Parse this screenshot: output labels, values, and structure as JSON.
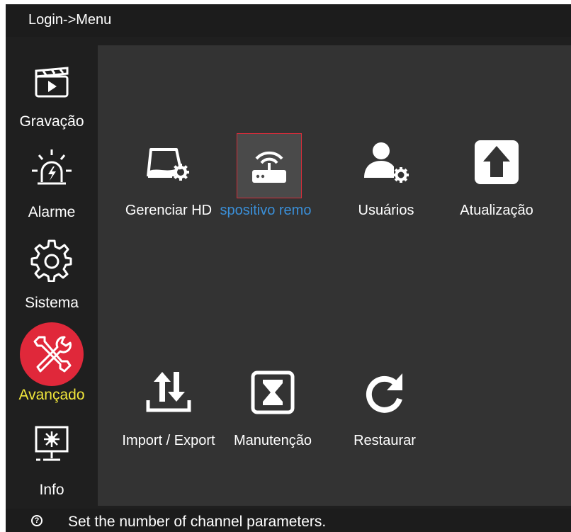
{
  "title": "Login->Menu",
  "sidebar": {
    "items": [
      {
        "label": "Gravação",
        "icon": "clapperboard-icon"
      },
      {
        "label": "Alarme",
        "icon": "siren-icon"
      },
      {
        "label": "Sistema",
        "icon": "gear-icon"
      },
      {
        "label": "Avançado",
        "icon": "tools-icon",
        "active": true
      },
      {
        "label": "Info",
        "icon": "monitor-info-icon"
      }
    ]
  },
  "tiles": [
    {
      "label": "Gerenciar HD",
      "icon": "hdd-settings-icon"
    },
    {
      "label": "spositivo remo",
      "icon": "router-wifi-icon",
      "selected": true
    },
    {
      "label": "Usuários",
      "icon": "user-settings-icon"
    },
    {
      "label": "Atualização",
      "icon": "upgrade-arrow-icon"
    },
    {
      "label": "Import / Export",
      "icon": "import-export-icon"
    },
    {
      "label": "Manutenção",
      "icon": "hourglass-icon"
    },
    {
      "label": "Restaurar",
      "icon": "restore-icon"
    }
  ],
  "status": {
    "message": "Set the number of channel parameters.",
    "icon": "help-icon"
  },
  "colors": {
    "active_label": "#f0e63b",
    "selected_label": "#3a8fd8",
    "active_circle": "#e0283a",
    "selection_border": "#d42d3a"
  }
}
